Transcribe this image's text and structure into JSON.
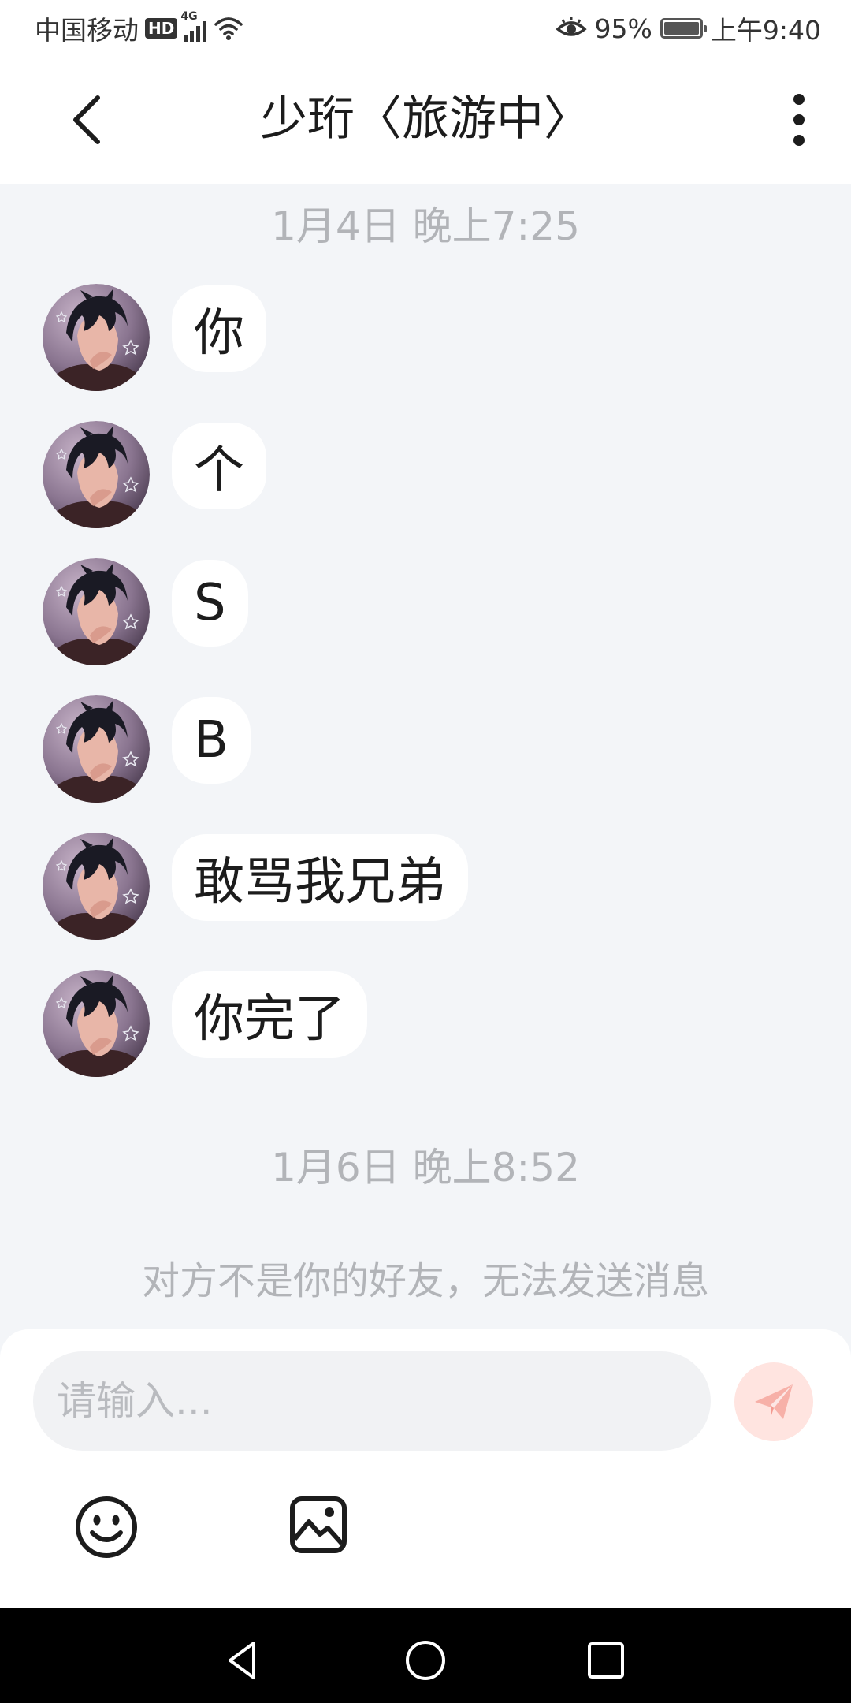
{
  "status_bar": {
    "carrier": "中国移动",
    "hd": "HD",
    "network": "4G",
    "battery_percent": "95%",
    "time": "上午9:40"
  },
  "header": {
    "title": "少珩〈旅游中〉"
  },
  "chat": {
    "timestamps": [
      "1月4日 晚上7:25",
      "1月6日 晚上8:52"
    ],
    "messages": [
      {
        "text": "你"
      },
      {
        "text": "个"
      },
      {
        "text": "S"
      },
      {
        "text": "B"
      },
      {
        "text": "敢骂我兄弟"
      },
      {
        "text": "你完了"
      }
    ],
    "notice": "对方不是你的好友，无法发送消息"
  },
  "composer": {
    "placeholder": "请输入..."
  },
  "icons": {
    "back": "chevron-left-icon",
    "more": "more-vertical-icon",
    "send": "paper-plane-icon",
    "emoji": "smiley-icon",
    "image": "image-icon",
    "nav_back": "triangle-back-icon",
    "nav_home": "circle-home-icon",
    "nav_recent": "square-recent-icon"
  },
  "colors": {
    "chat_background": "#f3f5f8",
    "bubble": "#ffffff",
    "muted_text": "#b2b4b8",
    "send_button": "#ffe4e0",
    "send_icon": "#f7b0a8"
  }
}
